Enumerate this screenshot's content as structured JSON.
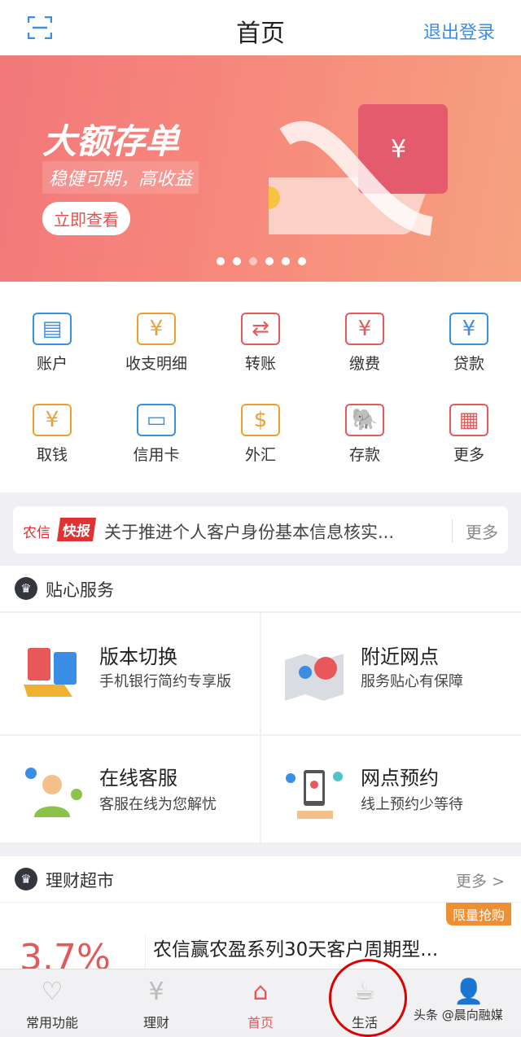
{
  "header": {
    "title": "首页",
    "logout": "退出登录",
    "scan_icon": "scan-icon"
  },
  "banner": {
    "headline": "大额存单",
    "subline": "稳健可期，高收益",
    "button": "立即查看",
    "slides": 6,
    "active_slide": 3
  },
  "shortcuts": [
    {
      "label": "账户",
      "icon": "id-card-icon",
      "color": "#3a8ee6",
      "glyph": "▤"
    },
    {
      "label": "收支明细",
      "icon": "ledger-icon",
      "color": "#f0a030",
      "glyph": "¥"
    },
    {
      "label": "转账",
      "icon": "transfer-icon",
      "color": "#e8585a",
      "glyph": "⇄"
    },
    {
      "label": "缴费",
      "icon": "house-yen-icon",
      "color": "#e8585a",
      "glyph": "¥"
    },
    {
      "label": "贷款",
      "icon": "loan-icon",
      "color": "#3a8ee6",
      "glyph": "¥"
    },
    {
      "label": "取钱",
      "icon": "withdraw-icon",
      "color": "#f0a030",
      "glyph": "¥"
    },
    {
      "label": "信用卡",
      "icon": "credit-card-icon",
      "color": "#3a8ee6",
      "glyph": "▭"
    },
    {
      "label": "外汇",
      "icon": "exchange-icon",
      "color": "#f0a030",
      "glyph": "$"
    },
    {
      "label": "存款",
      "icon": "elephant-icon",
      "color": "#e8585a",
      "glyph": "🐘"
    },
    {
      "label": "更多",
      "icon": "grid-icon",
      "color": "#e8585a",
      "glyph": "▦"
    }
  ],
  "news": {
    "brand": "农信",
    "tag": "快报",
    "text": "关于推进个人客户身份基本信息核实...",
    "more": "更多"
  },
  "care": {
    "title": "贴心服务",
    "items": [
      {
        "title": "版本切换",
        "desc": "手机银行简约专享版"
      },
      {
        "title": "附近网点",
        "desc": "服务贴心有保障"
      },
      {
        "title": "在线客服",
        "desc": "客服在线为您解忧"
      },
      {
        "title": "网点预约",
        "desc": "线上预约少等待"
      }
    ]
  },
  "market": {
    "title": "理财超市",
    "more": "更多 >",
    "product": {
      "rate": "3.7%",
      "name": "农信赢农盈系列30天客户周期型...",
      "badge": "限量抢购"
    }
  },
  "tabs": [
    {
      "label": "常用功能",
      "icon": "heart-icon",
      "glyph": "♡"
    },
    {
      "label": "理财",
      "icon": "yen-coin-icon",
      "glyph": "¥"
    },
    {
      "label": "首页",
      "icon": "home-icon",
      "glyph": "⌂"
    },
    {
      "label": "生活",
      "icon": "coffee-cup-icon",
      "glyph": "☕"
    },
    {
      "label": "",
      "icon": "user-icon",
      "glyph": "👤"
    }
  ],
  "active_tab": 2,
  "watermark": "头条 @晨向融媒"
}
